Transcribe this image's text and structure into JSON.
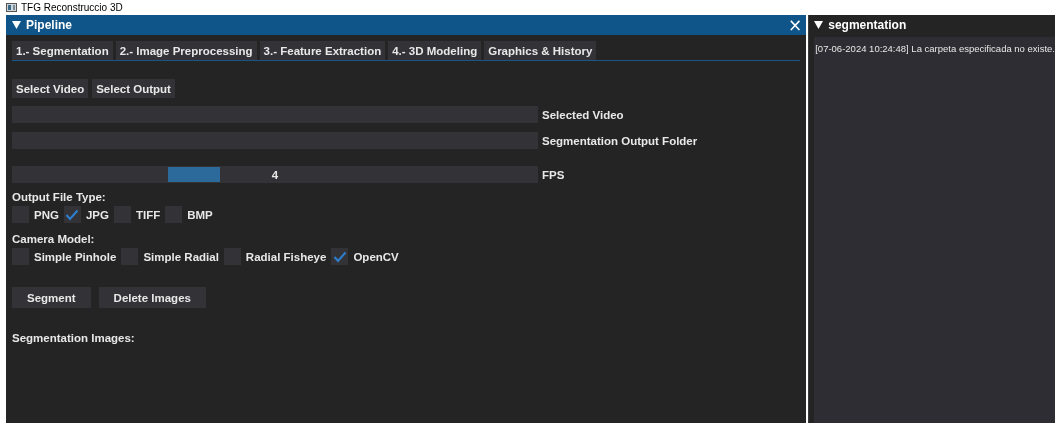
{
  "window": {
    "title": "TFG Reconstruccio 3D"
  },
  "pipeline": {
    "title": "Pipeline",
    "close": "×",
    "tabs": [
      {
        "label": "1.- Segmentation"
      },
      {
        "label": "2.- Image Preprocessing"
      },
      {
        "label": "3.- Feature Extraction"
      },
      {
        "label": "4.- 3D Modeling"
      },
      {
        "label": "Graphics & History"
      }
    ],
    "select_buttons": [
      "Select Video",
      "Select Output"
    ],
    "fields": [
      {
        "label": "Selected Video"
      },
      {
        "label": "Segmentation Output Folder"
      }
    ],
    "fps_slider": {
      "label": "FPS",
      "value": "4",
      "level": 0.33
    },
    "output_file_type": {
      "label": "Output File Type:",
      "options": [
        {
          "label": "PNG",
          "checked": false
        },
        {
          "label": "JPG",
          "checked": true
        },
        {
          "label": "TIFF",
          "checked": false
        },
        {
          "label": "BMP",
          "checked": false
        }
      ]
    },
    "camera_model": {
      "label": "Camera Model:",
      "options": [
        {
          "label": "Simple Pinhole",
          "checked": false
        },
        {
          "label": "Simple Radial",
          "checked": false
        },
        {
          "label": "Radial Fisheye",
          "checked": false
        },
        {
          "label": "OpenCV",
          "checked": true
        }
      ]
    },
    "action_buttons": [
      "Segment",
      "Delete Images"
    ],
    "images_label": "Segmentation Images:"
  },
  "log_panel": {
    "title": "segmentation",
    "messages": [
      "[07-06-2024 10:24:48] La carpeta especificada no existe."
    ]
  }
}
